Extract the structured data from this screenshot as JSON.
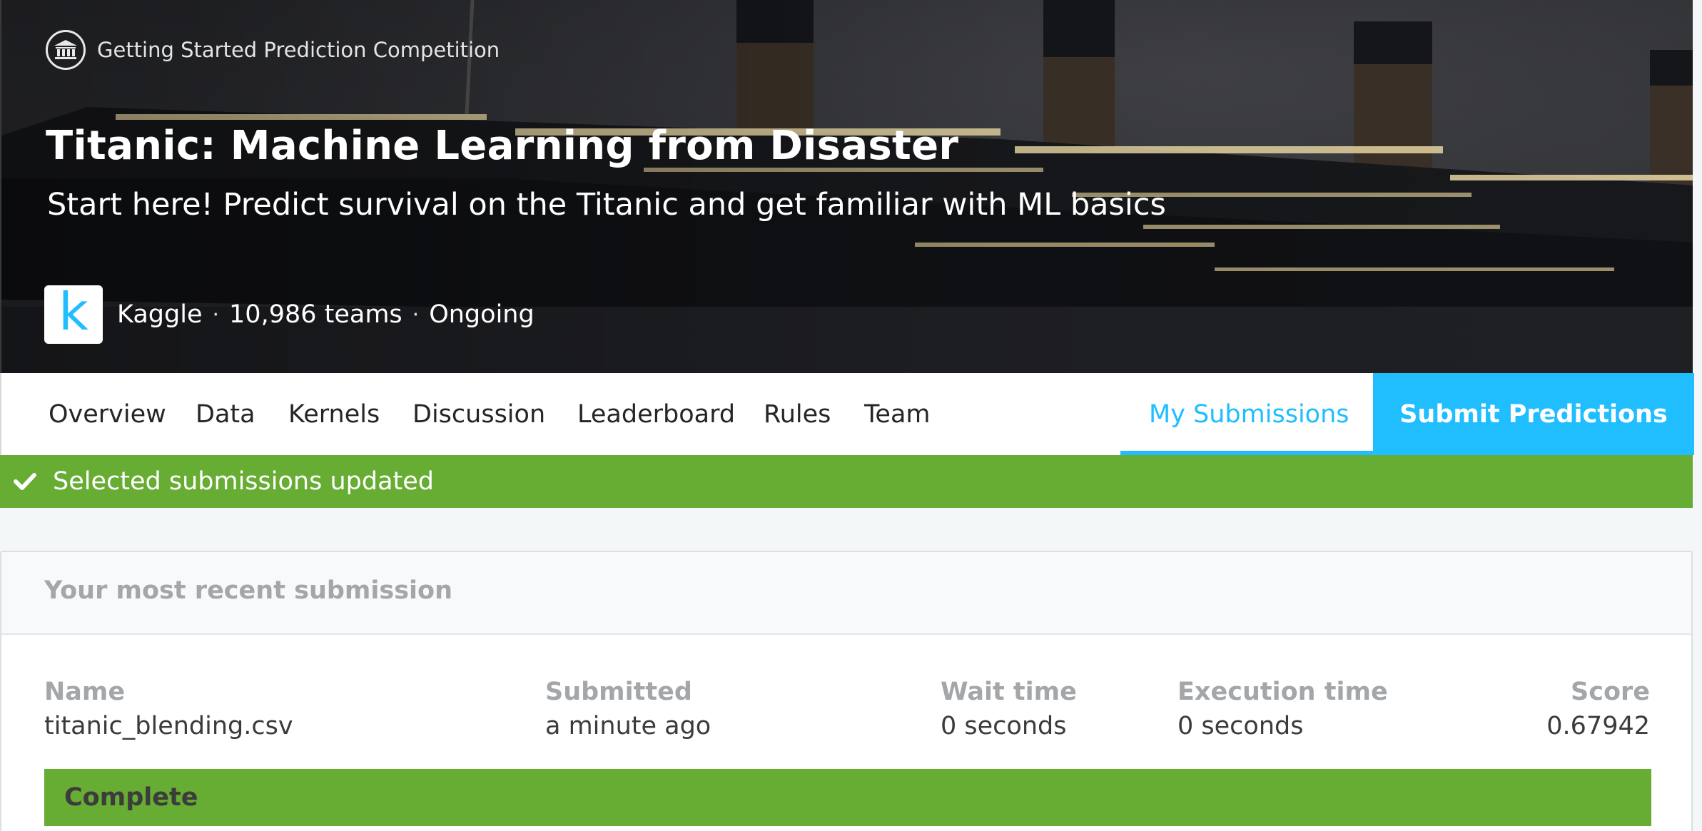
{
  "hero": {
    "competition_type": "Getting Started Prediction Competition",
    "title": "Titanic: Machine Learning from Disaster",
    "subtitle": "Start here! Predict survival on the Titanic and get familiar with ML basics",
    "host": "Kaggle",
    "teams": "10,986 teams",
    "status": "Ongoing",
    "logo_letter": "k",
    "competition_icon": "bank-icon",
    "separator": "·"
  },
  "tabs": {
    "items": [
      {
        "label": "Overview"
      },
      {
        "label": "Data"
      },
      {
        "label": "Kernels"
      },
      {
        "label": "Discussion"
      },
      {
        "label": "Leaderboard"
      },
      {
        "label": "Rules"
      },
      {
        "label": "Team"
      }
    ],
    "active": "My Submissions",
    "submit": "Submit Predictions"
  },
  "alert": {
    "message": "Selected submissions updated",
    "icon": "check-icon"
  },
  "recent_submission": {
    "header": "Your most recent submission",
    "columns": {
      "name": "Name",
      "submitted": "Submitted",
      "wait": "Wait time",
      "execution": "Execution time",
      "score": "Score"
    },
    "row": {
      "name": "titanic_blending.csv",
      "submitted": "a minute ago",
      "wait": "0 seconds",
      "execution": "0 seconds",
      "score": "0.67942"
    },
    "status": "Complete"
  },
  "colors": {
    "accent": "#20beff",
    "success": "#67ac33",
    "muted_text": "#a3a7aa"
  }
}
